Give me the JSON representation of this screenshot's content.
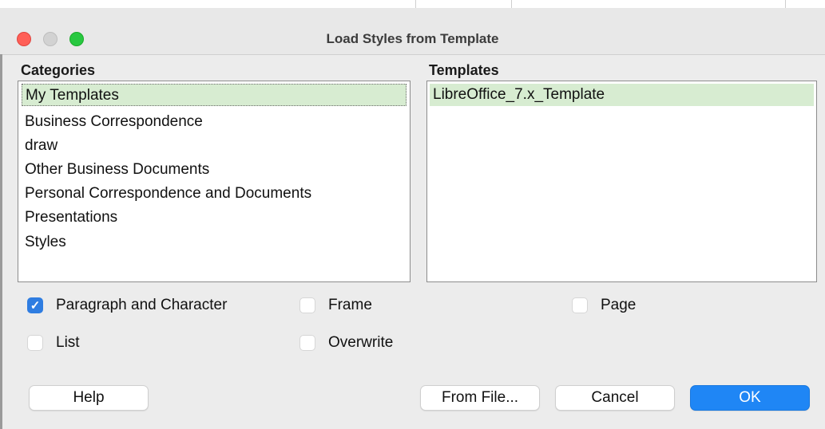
{
  "window": {
    "title": "Load Styles from Template"
  },
  "categories": {
    "label": "Categories",
    "items": [
      "My Templates",
      "Business Correspondence",
      "draw",
      "Other Business Documents",
      "Personal Correspondence and Documents",
      "Presentations",
      "Styles"
    ],
    "selected_index": 0
  },
  "templates": {
    "label": "Templates",
    "items": [
      "LibreOffice_7.x_Template"
    ],
    "selected_index": 0
  },
  "options": {
    "paragraph_and_character": {
      "label": "Paragraph and Character",
      "checked": true
    },
    "frame": {
      "label": "Frame",
      "checked": false
    },
    "page": {
      "label": "Page",
      "checked": false
    },
    "list": {
      "label": "List",
      "checked": false
    },
    "overwrite": {
      "label": "Overwrite",
      "checked": false
    }
  },
  "buttons": {
    "help": "Help",
    "from_file": "From File...",
    "cancel": "Cancel",
    "ok": "OK"
  },
  "colors": {
    "selection": "#d7ecd1",
    "accent": "#1f86f5",
    "close": "#ff5f57",
    "maximize": "#28c840"
  }
}
